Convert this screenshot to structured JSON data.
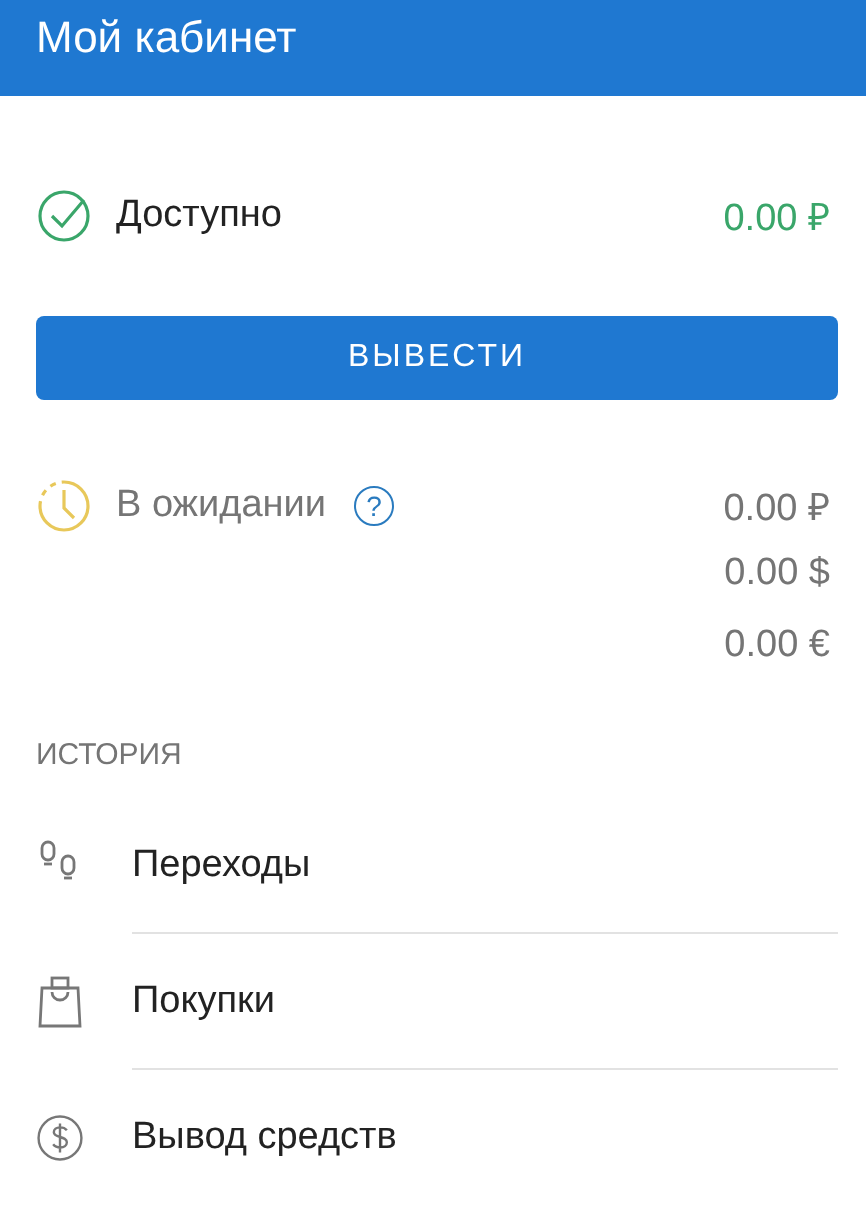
{
  "header": {
    "title": "Мой кабинет"
  },
  "available": {
    "label": "Доступно",
    "amount": "0.00 ₽"
  },
  "withdraw_button": {
    "label": "ВЫВЕСТИ"
  },
  "pending": {
    "label": "В ожидании",
    "help": "?",
    "amounts": [
      "0.00 ₽",
      "0.00 $",
      "0.00 €"
    ]
  },
  "history": {
    "title": "ИСТОРИЯ",
    "items": [
      {
        "kind": "steps",
        "label": "Переходы"
      },
      {
        "kind": "bag",
        "label": "Покупки"
      },
      {
        "kind": "dollar",
        "label": "Вывод средств"
      }
    ]
  }
}
